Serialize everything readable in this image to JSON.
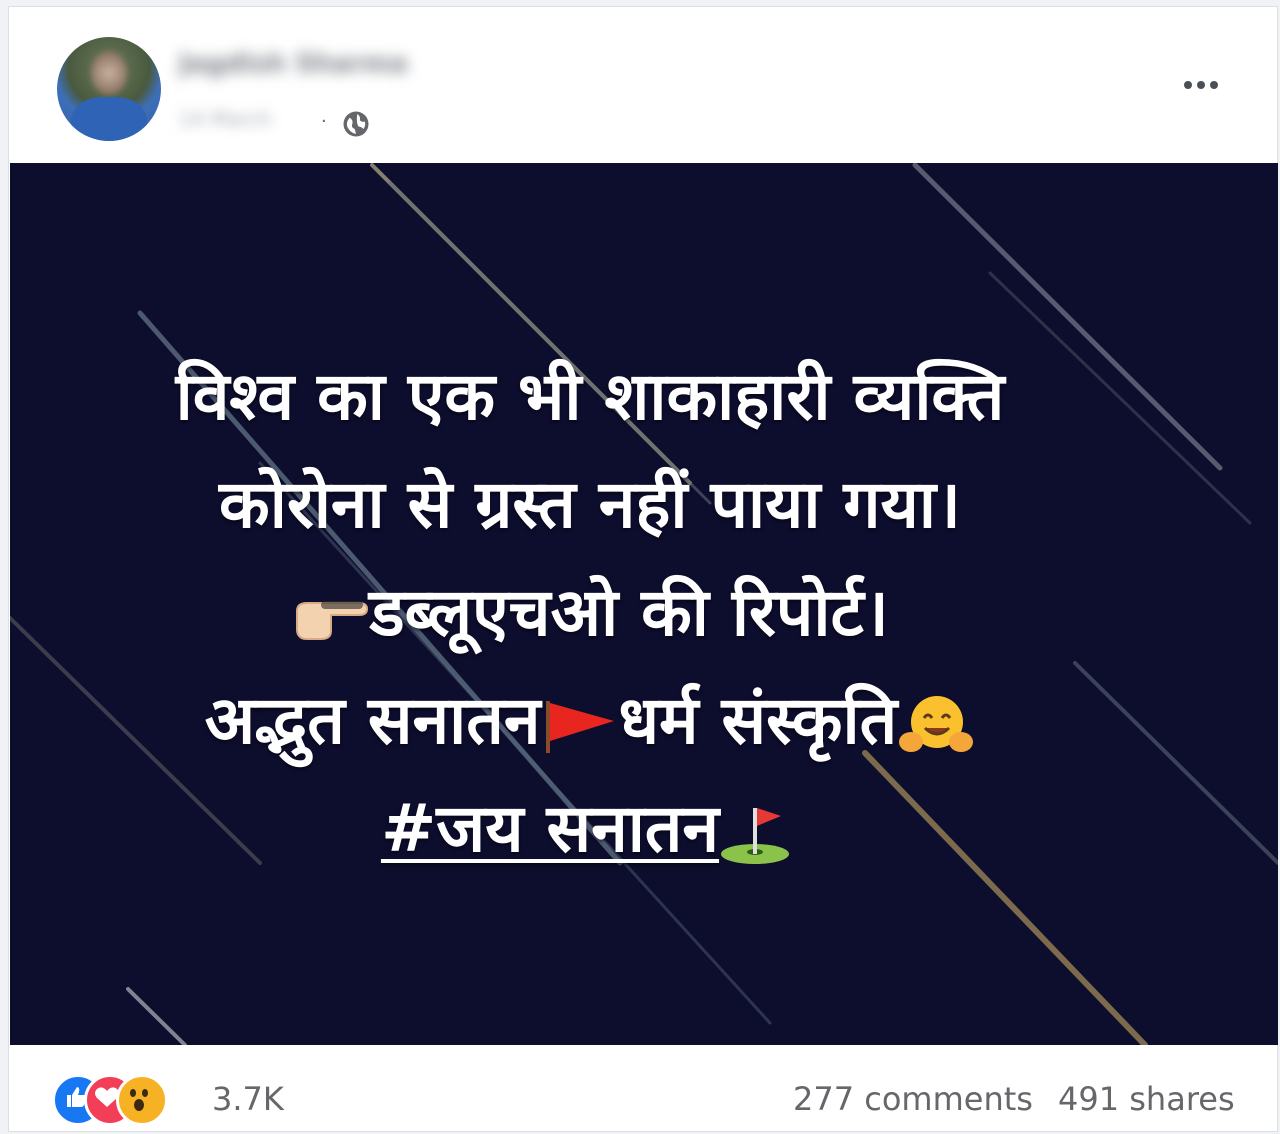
{
  "author": {
    "name": "Jagdish Sharma",
    "date": "14 March"
  },
  "post": {
    "lines": [
      "विश्व का एक भी शाकाहारी व्यक्ति",
      "कोरोना से ग्रस्त नहीं पाया गया।",
      "डब्लूएचओ की रिपोर्ट।",
      "अद्भुत सनातन",
      "धर्म संस्कृति",
      "#जय  सनातन"
    ],
    "emojis": [
      "backhand-index-pointing-right",
      "triangular-flag",
      "hugging-face",
      "flag-in-hole"
    ]
  },
  "stats": {
    "reaction_count": "3.7K",
    "comments": "277 comments",
    "shares": "491 shares",
    "reactions": [
      "like",
      "love",
      "wow"
    ]
  },
  "colors": {
    "image_bg": "#0d0d2e",
    "like": "#1877f2",
    "love": "#f33e58",
    "wow": "#f7b125"
  }
}
